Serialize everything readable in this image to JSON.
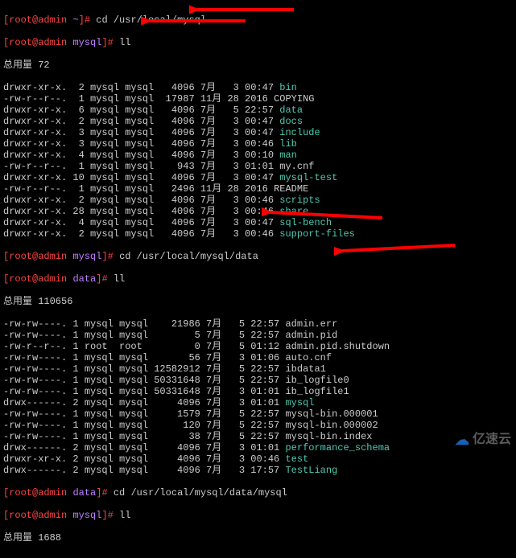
{
  "prompts": {
    "p1": {
      "user": "root",
      "host": "admin",
      "path": "~",
      "cmd": "cd /usr/local/mysql"
    },
    "p2": {
      "user": "root",
      "host": "admin",
      "path": "mysql",
      "cmd": "ll"
    },
    "p3": {
      "user": "root",
      "host": "admin",
      "path": "mysql",
      "cmd": "cd /usr/local/mysql/data"
    },
    "p4": {
      "user": "root",
      "host": "admin",
      "path": "data",
      "cmd": "ll"
    },
    "p5": {
      "user": "root",
      "host": "admin",
      "path": "data",
      "cmd": "cd /usr/local/mysql/data/mysql"
    },
    "p6": {
      "user": "root",
      "host": "admin",
      "path": "mysql",
      "cmd": "ll"
    }
  },
  "total1": "总用量 72",
  "total2": "总用量 110656",
  "total3": "总用量 1688",
  "listing1": [
    {
      "perm": "drwxr-xr-x.",
      "n": " 2",
      "own": "mysql mysql",
      "size": "  4096",
      "mon": "7月",
      "d": "  3",
      "time": "00:47",
      "name": "bin",
      "cls": "cyan"
    },
    {
      "perm": "-rw-r--r--.",
      "n": " 1",
      "own": "mysql mysql",
      "size": " 17987",
      "mon": "11月",
      "d": "28",
      "time": "2016",
      "name": "COPYING",
      "cls": "white"
    },
    {
      "perm": "drwxr-xr-x.",
      "n": " 6",
      "own": "mysql mysql",
      "size": "  4096",
      "mon": "7月",
      "d": "  5",
      "time": "22:57",
      "name": "data",
      "cls": "cyan"
    },
    {
      "perm": "drwxr-xr-x.",
      "n": " 2",
      "own": "mysql mysql",
      "size": "  4096",
      "mon": "7月",
      "d": "  3",
      "time": "00:47",
      "name": "docs",
      "cls": "cyan"
    },
    {
      "perm": "drwxr-xr-x.",
      "n": " 3",
      "own": "mysql mysql",
      "size": "  4096",
      "mon": "7月",
      "d": "  3",
      "time": "00:47",
      "name": "include",
      "cls": "cyan"
    },
    {
      "perm": "drwxr-xr-x.",
      "n": " 3",
      "own": "mysql mysql",
      "size": "  4096",
      "mon": "7月",
      "d": "  3",
      "time": "00:46",
      "name": "lib",
      "cls": "cyan"
    },
    {
      "perm": "drwxr-xr-x.",
      "n": " 4",
      "own": "mysql mysql",
      "size": "  4096",
      "mon": "7月",
      "d": "  3",
      "time": "00:10",
      "name": "man",
      "cls": "cyan"
    },
    {
      "perm": "-rw-r--r--.",
      "n": " 1",
      "own": "mysql mysql",
      "size": "   943",
      "mon": "7月",
      "d": "  3",
      "time": "01:01",
      "name": "my.cnf",
      "cls": "white"
    },
    {
      "perm": "drwxr-xr-x.",
      "n": "10",
      "own": "mysql mysql",
      "size": "  4096",
      "mon": "7月",
      "d": "  3",
      "time": "00:47",
      "name": "mysql-test",
      "cls": "cyan"
    },
    {
      "perm": "-rw-r--r--.",
      "n": " 1",
      "own": "mysql mysql",
      "size": "  2496",
      "mon": "11月",
      "d": "28",
      "time": "2016",
      "name": "README",
      "cls": "white"
    },
    {
      "perm": "drwxr-xr-x.",
      "n": " 2",
      "own": "mysql mysql",
      "size": "  4096",
      "mon": "7月",
      "d": "  3",
      "time": "00:46",
      "name": "scripts",
      "cls": "cyan"
    },
    {
      "perm": "drwxr-xr-x.",
      "n": "28",
      "own": "mysql mysql",
      "size": "  4096",
      "mon": "7月",
      "d": "  3",
      "time": "00:46",
      "name": "share",
      "cls": "cyan"
    },
    {
      "perm": "drwxr-xr-x.",
      "n": " 4",
      "own": "mysql mysql",
      "size": "  4096",
      "mon": "7月",
      "d": "  3",
      "time": "00:47",
      "name": "sql-bench",
      "cls": "cyan"
    },
    {
      "perm": "drwxr-xr-x.",
      "n": " 2",
      "own": "mysql mysql",
      "size": "  4096",
      "mon": "7月",
      "d": "  3",
      "time": "00:46",
      "name": "support-files",
      "cls": "cyan"
    }
  ],
  "listing2": [
    {
      "perm": "-rw-rw----.",
      "n": "1",
      "own": "mysql mysql",
      "size": "   21986",
      "mon": "7月",
      "d": "  5",
      "time": "22:57",
      "name": "admin.err",
      "cls": "white"
    },
    {
      "perm": "-rw-rw----.",
      "n": "1",
      "own": "mysql mysql",
      "size": "       5",
      "mon": "7月",
      "d": "  5",
      "time": "22:57",
      "name": "admin.pid",
      "cls": "white"
    },
    {
      "perm": "-rw-r--r--.",
      "n": "1",
      "own": "root  root ",
      "size": "       0",
      "mon": "7月",
      "d": "  5",
      "time": "01:12",
      "name": "admin.pid.shutdown",
      "cls": "white"
    },
    {
      "perm": "-rw-rw----.",
      "n": "1",
      "own": "mysql mysql",
      "size": "      56",
      "mon": "7月",
      "d": "  3",
      "time": "01:06",
      "name": "auto.cnf",
      "cls": "white"
    },
    {
      "perm": "-rw-rw----.",
      "n": "1",
      "own": "mysql mysql",
      "size": "12582912",
      "mon": "7月",
      "d": "  5",
      "time": "22:57",
      "name": "ibdata1",
      "cls": "white"
    },
    {
      "perm": "-rw-rw----.",
      "n": "1",
      "own": "mysql mysql",
      "size": "50331648",
      "mon": "7月",
      "d": "  5",
      "time": "22:57",
      "name": "ib_logfile0",
      "cls": "white"
    },
    {
      "perm": "-rw-rw----.",
      "n": "1",
      "own": "mysql mysql",
      "size": "50331648",
      "mon": "7月",
      "d": "  3",
      "time": "01:01",
      "name": "ib_logfile1",
      "cls": "white"
    },
    {
      "perm": "drwx------.",
      "n": "2",
      "own": "mysql mysql",
      "size": "    4096",
      "mon": "7月",
      "d": "  3",
      "time": "01:01",
      "name": "mysql",
      "cls": "cyan"
    },
    {
      "perm": "-rw-rw----.",
      "n": "1",
      "own": "mysql mysql",
      "size": "    1579",
      "mon": "7月",
      "d": "  5",
      "time": "22:57",
      "name": "mysql-bin.000001",
      "cls": "white"
    },
    {
      "perm": "-rw-rw----.",
      "n": "1",
      "own": "mysql mysql",
      "size": "     120",
      "mon": "7月",
      "d": "  5",
      "time": "22:57",
      "name": "mysql-bin.000002",
      "cls": "white"
    },
    {
      "perm": "-rw-rw----.",
      "n": "1",
      "own": "mysql mysql",
      "size": "      38",
      "mon": "7月",
      "d": "  5",
      "time": "22:57",
      "name": "mysql-bin.index",
      "cls": "white"
    },
    {
      "perm": "drwx------.",
      "n": "2",
      "own": "mysql mysql",
      "size": "    4096",
      "mon": "7月",
      "d": "  3",
      "time": "01:01",
      "name": "performance_schema",
      "cls": "cyan"
    },
    {
      "perm": "drwxr-xr-x.",
      "n": "2",
      "own": "mysql mysql",
      "size": "    4096",
      "mon": "7月",
      "d": "  3",
      "time": "00:46",
      "name": "test",
      "cls": "cyan"
    },
    {
      "perm": "drwx------.",
      "n": "2",
      "own": "mysql mysql",
      "size": "    4096",
      "mon": "7月",
      "d": "  3",
      "time": "17:57",
      "name": "TestLiang",
      "cls": "cyan"
    }
  ],
  "watermark": "亿速云"
}
